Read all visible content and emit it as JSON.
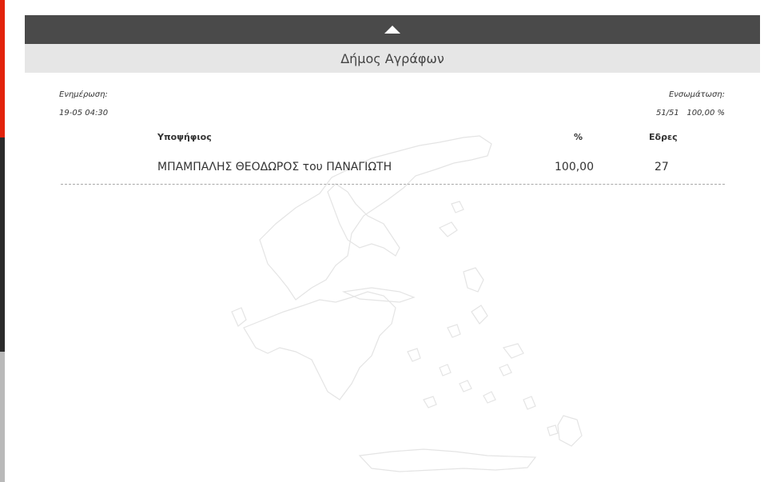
{
  "header": {
    "title": "Δήμος Αγράφων"
  },
  "meta": {
    "update_label": "Ενημέρωση:",
    "update_value": "19-05 04:30",
    "integration_label": "Ενσωμάτωση:",
    "integration_count": "51/51",
    "integration_percent": "100,00 %"
  },
  "table": {
    "columns": {
      "candidate": "Υποψήφιος",
      "percent": "%",
      "seats": "Εδρες"
    },
    "rows": [
      {
        "candidate": "ΜΠΑΜΠΑΛΗΣ ΘΕΟΔΩΡΟΣ του ΠΑΝΑΓΙΩΤΗ",
        "percent": "100,00",
        "seats": "27"
      }
    ]
  },
  "icons": {
    "collapse": "arrow-up-icon",
    "background": "greece-map-icon"
  },
  "colors": {
    "collapse_bar": "#4a4a4a",
    "title_bar": "#e6e6e6",
    "accent_red": "#e2230c",
    "sidebar_dark": "#2b2b2b",
    "sidebar_grey": "#b9b9b9"
  }
}
